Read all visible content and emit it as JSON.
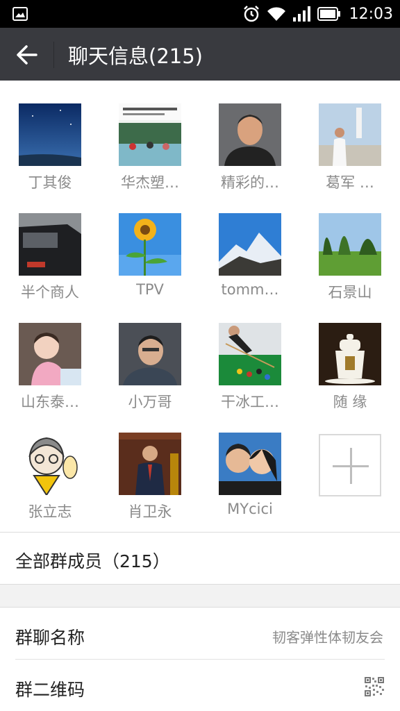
{
  "status_bar": {
    "time": "12:03"
  },
  "header": {
    "title": "聊天信息(215)"
  },
  "members": [
    {
      "name": "丁其俊"
    },
    {
      "name": "华杰塑…"
    },
    {
      "name": "精彩的…"
    },
    {
      "name": "葛军 …"
    },
    {
      "name": "半个商人"
    },
    {
      "name": "TPV"
    },
    {
      "name": "tomm…"
    },
    {
      "name": "石景山"
    },
    {
      "name": "山东泰…"
    },
    {
      "name": "小万哥"
    },
    {
      "name": "干冰工…"
    },
    {
      "name": "随 缘"
    },
    {
      "name": "张立志"
    },
    {
      "name": "肖卫永"
    },
    {
      "name": "MYcici"
    }
  ],
  "all_members": {
    "label": "全部群成员（215）"
  },
  "group_name": {
    "label": "群聊名称",
    "value": "韧客弹性体韧友会"
  },
  "qr_code": {
    "label": "群二维码"
  },
  "colors": {
    "header_bg": "#393a3f",
    "status_bg": "#000000",
    "page_bg": "#f2f2f2",
    "name_text": "#8a8a8a"
  }
}
